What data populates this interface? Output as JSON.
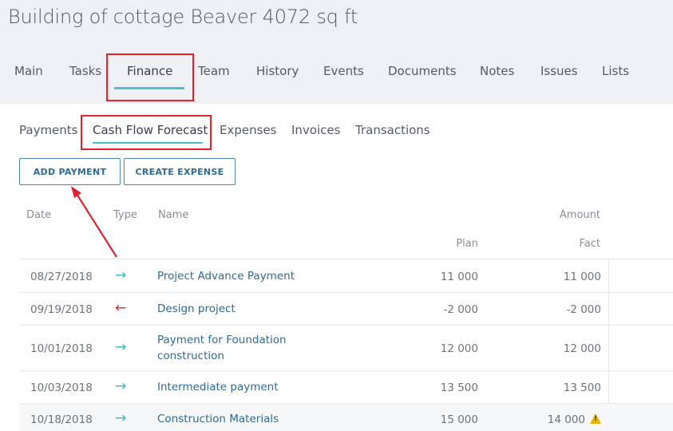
{
  "page": {
    "title": "Building of cottage Beaver 4072 sq ft"
  },
  "main_tabs": [
    {
      "label": "Main"
    },
    {
      "label": "Tasks"
    },
    {
      "label": "Finance"
    },
    {
      "label": "Team"
    },
    {
      "label": "History"
    },
    {
      "label": "Events"
    },
    {
      "label": "Documents"
    },
    {
      "label": "Notes"
    },
    {
      "label": "Issues"
    },
    {
      "label": "Lists"
    }
  ],
  "main_tab_active": "Finance",
  "sub_tabs": [
    {
      "label": "Payments"
    },
    {
      "label": "Cash Flow Forecast"
    },
    {
      "label": "Expenses"
    },
    {
      "label": "Invoices"
    },
    {
      "label": "Transactions"
    }
  ],
  "sub_tab_active": "Cash Flow Forecast",
  "buttons": {
    "add_payment": "ADD PAYMENT",
    "create_expense": "CREATE EXPENSE"
  },
  "table": {
    "headers": {
      "date": "Date",
      "type": "Type",
      "name": "Name",
      "amount": "Amount",
      "plan": "Plan",
      "fact": "Fact"
    },
    "rows": [
      {
        "date": "08/27/2018",
        "type": "incoming",
        "name": "Project Advance Payment",
        "plan": "11 000",
        "fact": "11 000"
      },
      {
        "date": "09/19/2018",
        "type": "outgoing",
        "name": "Design project",
        "plan": "-2 000",
        "fact": "-2 000"
      },
      {
        "date": "10/01/2018",
        "type": "incoming",
        "name": "Payment for Foundation construction",
        "plan": "12 000",
        "fact": "12 000"
      },
      {
        "date": "10/03/2018",
        "type": "incoming",
        "name": "Intermediate payment",
        "plan": "13 500",
        "fact": "13 500"
      },
      {
        "date": "10/18/2018",
        "type": "incoming",
        "name": "Construction Materials",
        "plan": "15 000",
        "fact": "14 000",
        "warning": true
      }
    ]
  },
  "colors": {
    "accent": "#45c1cf",
    "link": "#2f6a96",
    "highlight": "#e2222c",
    "incoming": "#3bb8c4",
    "outgoing": "#d62a2a",
    "warning": "#e8b400"
  },
  "icons": {
    "incoming": "arrow-right-icon",
    "outgoing": "arrow-left-icon",
    "warning": "warning-icon"
  }
}
